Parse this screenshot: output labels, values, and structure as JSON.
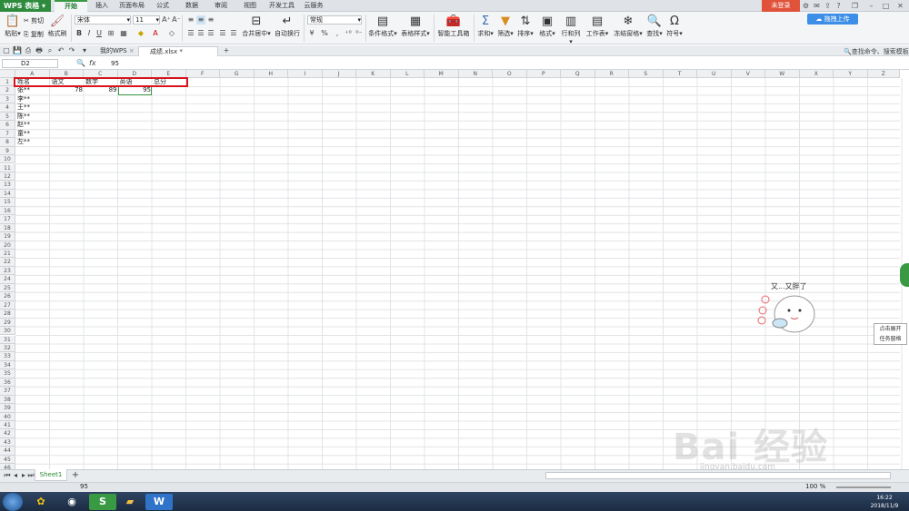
{
  "app": {
    "menu_label": "WPS 表格",
    "login_label": "未登录"
  },
  "ribbon_tabs": [
    "开始",
    "插入",
    "页面布局",
    "公式",
    "数据",
    "审阅",
    "视图",
    "开发工具",
    "云服务"
  ],
  "ribbon": {
    "paste": "粘贴",
    "cut": "剪切",
    "copy": "复制",
    "format_painter": "格式刷",
    "font_name": "宋体",
    "font_size": "11",
    "merge_center": "合并居中",
    "wrap": "自动换行",
    "number_format": "常规",
    "cond_format": "条件格式",
    "table_style": "表格样式",
    "smart_tools": "智能工具箱",
    "sum": "求和",
    "filter": "筛选",
    "sort": "排序",
    "format": "格式",
    "row_col": "行和列",
    "worksheet": "工作表",
    "freeze": "冻结窗格",
    "find": "查找",
    "symbol": "符号",
    "cloud_upload": "拖拽上传",
    "search_cmd": "查找命令、搜索模板"
  },
  "doc_tabs": [
    "我的WPS",
    "成绩.xlsx *"
  ],
  "formula_bar": {
    "cell_ref": "D2",
    "fx": "fx",
    "content": "95"
  },
  "columns": [
    "A",
    "B",
    "C",
    "D",
    "E",
    "F",
    "G",
    "H",
    "I",
    "J",
    "K",
    "L",
    "M",
    "N",
    "O",
    "P",
    "Q",
    "R",
    "S",
    "T",
    "U",
    "V",
    "W",
    "X",
    "Y",
    "Z"
  ],
  "rows": [
    "1",
    "2",
    "3",
    "4",
    "5",
    "6",
    "7",
    "8",
    "9",
    "10",
    "11",
    "12",
    "13",
    "14",
    "15",
    "16",
    "17",
    "18",
    "19",
    "20",
    "21",
    "22",
    "23",
    "24",
    "25",
    "26",
    "27",
    "28",
    "29",
    "30",
    "31",
    "32",
    "33",
    "34",
    "35",
    "36",
    "37",
    "38",
    "39",
    "40",
    "41",
    "42",
    "43",
    "44",
    "45",
    "46"
  ],
  "cells": {
    "A1": "姓名",
    "B1": "语文",
    "C1": "数学",
    "D1": "英语",
    "E1": "总分",
    "A2": "张**",
    "B2": "78",
    "C2": "89",
    "D2": "95",
    "A3": "李**",
    "A4": "王**",
    "A5": "陈**",
    "A6": "赵**",
    "A7": "童**",
    "A8": "左**"
  },
  "sheet_tabs": [
    "Sheet1"
  ],
  "status": {
    "value": "95",
    "zoom": "100 %"
  },
  "sticker_text": "又...又胖了",
  "side_tip": [
    "点击展开",
    "任务窗格"
  ],
  "watermark": {
    "main": "Bai 经验",
    "sub": "jingyan.baidu.com"
  },
  "clock": {
    "time": "16:22",
    "date": "2018/11/9"
  },
  "colors": {
    "wps_green": "#2e8b3d",
    "highlight_red": "#d8151d",
    "selected_green": "#3a9a44"
  }
}
